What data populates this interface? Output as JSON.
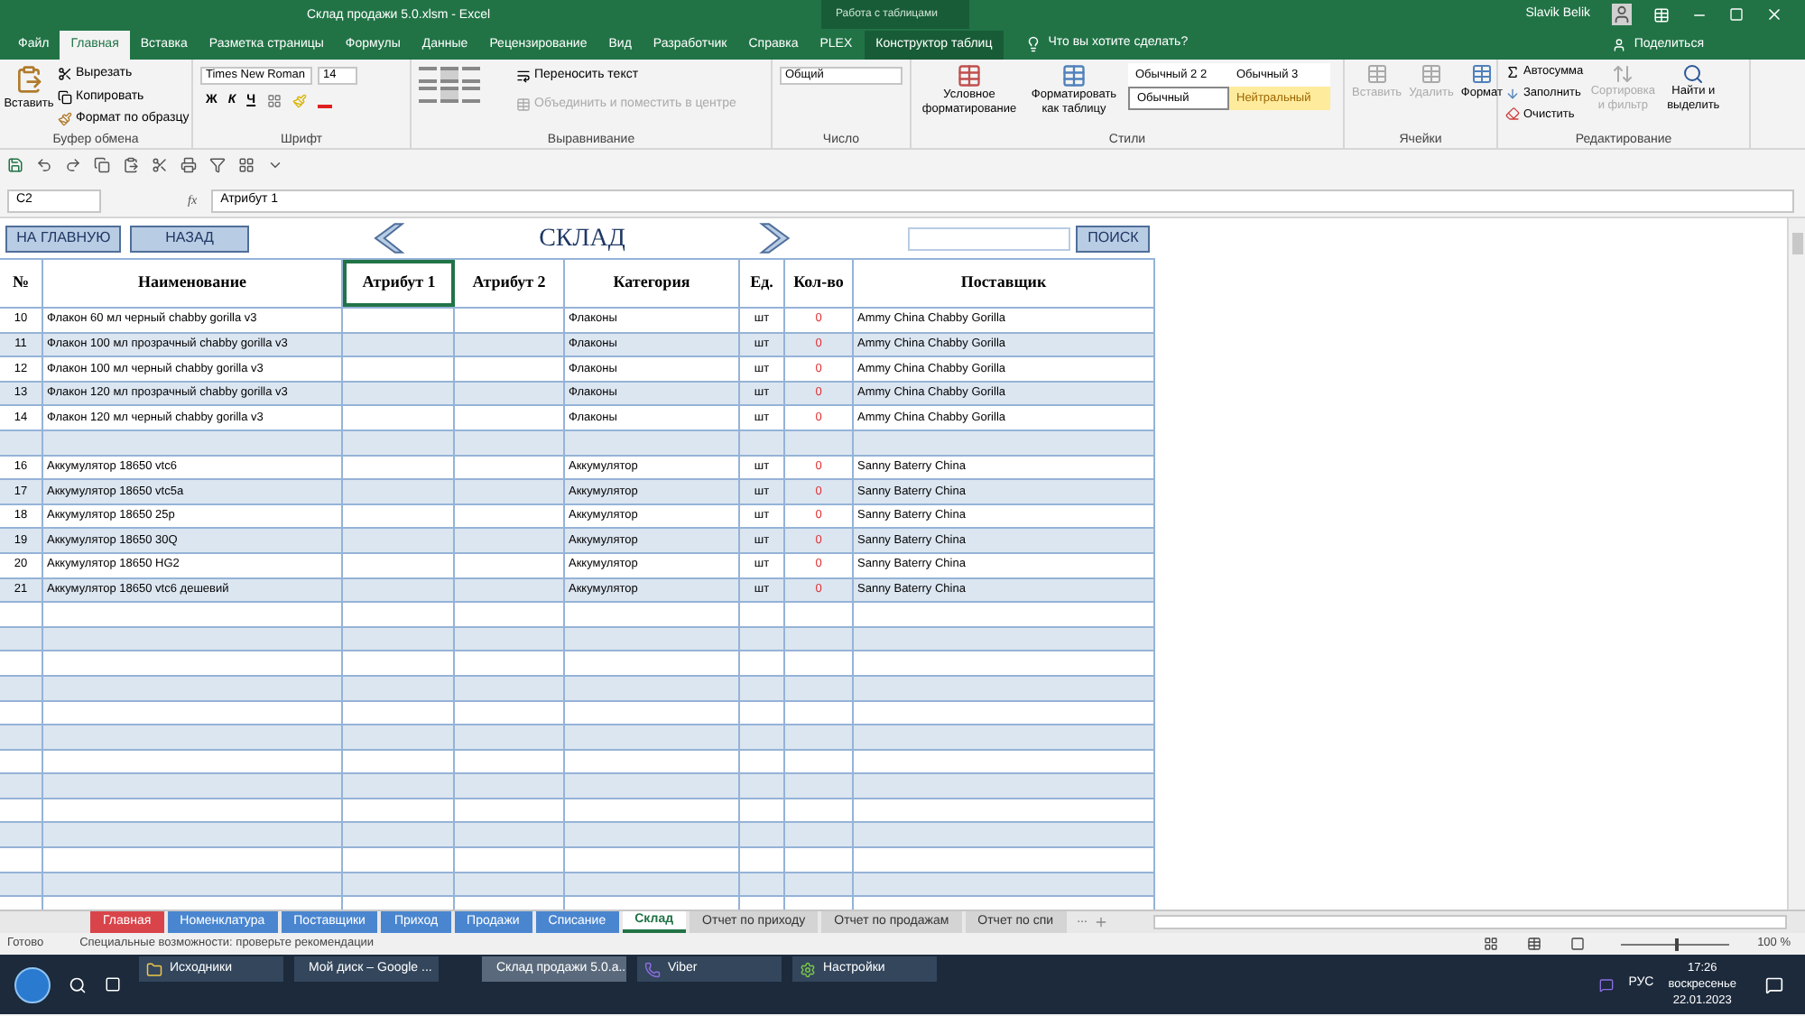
{
  "title_bar": {
    "title": "Склад продажи 5.0.xlsm  -  Excel",
    "context_label": "Работа с таблицами",
    "user_name": "Slavik Belik"
  },
  "menu_tabs": [
    {
      "label": "Файл",
      "selected": false
    },
    {
      "label": "Главная",
      "selected": true
    },
    {
      "label": "Вставка",
      "selected": false
    },
    {
      "label": "Разметка страницы",
      "selected": false
    },
    {
      "label": "Формулы",
      "selected": false
    },
    {
      "label": "Данные",
      "selected": false
    },
    {
      "label": "Рецензирование",
      "selected": false
    },
    {
      "label": "Вид",
      "selected": false
    },
    {
      "label": "Разработчик",
      "selected": false
    },
    {
      "label": "Справка",
      "selected": false
    },
    {
      "label": "PLEX",
      "selected": false
    },
    {
      "label": "Конструктор таблиц",
      "selected": false
    }
  ],
  "tell_me": "Что вы хотите сделать?",
  "share": "Поделиться",
  "ribbon": {
    "clipboard": {
      "paste": "Вставить",
      "cut": "Вырезать",
      "copy": "Копировать",
      "format_painter": "Формат по образцу",
      "label": "Буфер обмена"
    },
    "font": {
      "family": "Times New Roman",
      "size": "14",
      "format_buttons": [
        "Ж",
        "К",
        "Ч"
      ],
      "label": "Шрифт"
    },
    "alignment": {
      "wrap": "Переносить текст",
      "merge": "Объединить и поместить в центре",
      "label": "Выравнивание"
    },
    "number": {
      "format": "Общий",
      "label": "Число"
    },
    "styles": {
      "conditional": "Условное форматирование",
      "as_table": "Форматировать как таблицу",
      "cells": [
        {
          "label": "Обычный 2 2",
          "kind": "plain",
          "selected": false
        },
        {
          "label": "Обычный 3",
          "kind": "plain",
          "selected": false
        },
        {
          "label": "Обычный",
          "kind": "plain",
          "selected": true
        },
        {
          "label": "Нейтральный",
          "kind": "neutral",
          "selected": false
        }
      ],
      "label": "Стили"
    },
    "cells": {
      "insert": "Вставить",
      "delete": "Удалить",
      "format": "Формат",
      "label": "Ячейки"
    },
    "editing": {
      "autosum": "Автосумма",
      "fill": "Заполнить",
      "clear": "Очистить",
      "sort": "Сортировка и фильтр",
      "find": "Найти и выделить",
      "label": "Редактирование"
    }
  },
  "formula_bar": {
    "name_box": "C2",
    "fx": "fx",
    "formula": "Атрибут 1"
  },
  "sheet": {
    "home_button": "НА ГЛАВНУЮ",
    "back_button": "НАЗАД",
    "title": "СКЛАД",
    "search_button": "ПОИСК",
    "columns": [
      {
        "label": "№",
        "selected": false
      },
      {
        "label": "Наименование",
        "selected": false
      },
      {
        "label": "Атрибут 1",
        "selected": true
      },
      {
        "label": "Атрибут 2",
        "selected": false
      },
      {
        "label": "Категория",
        "selected": false
      },
      {
        "label": "Ед.",
        "selected": false
      },
      {
        "label": "Кол-во",
        "selected": false
      },
      {
        "label": "Поставщик",
        "selected": false
      }
    ],
    "rows": [
      {
        "kind": "item",
        "number": "10",
        "name": "Флакон 60 мл черный chabby gorilla v3",
        "category": "Флаконы",
        "unit": "шт",
        "qty": "0",
        "supplier": "Ammy China Chabby Gorilla"
      },
      {
        "kind": "item",
        "number": "11",
        "name": "Флакон 100 мл прозрачный chabby gorilla v3",
        "category": "Флаконы",
        "unit": "шт",
        "qty": "0",
        "supplier": "Ammy China Chabby Gorilla"
      },
      {
        "kind": "item",
        "number": "12",
        "name": "Флакон 100 мл черный chabby gorilla v3",
        "category": "Флаконы",
        "unit": "шт",
        "qty": "0",
        "supplier": "Ammy China Chabby Gorilla"
      },
      {
        "kind": "item",
        "number": "13",
        "name": "Флакон 120 мл прозрачный chabby gorilla v3",
        "category": "Флаконы",
        "unit": "шт",
        "qty": "0",
        "supplier": "Ammy China Chabby Gorilla"
      },
      {
        "kind": "item",
        "number": "14",
        "name": "Флакон 120 мл черный chabby gorilla v3",
        "category": "Флаконы",
        "unit": "шт",
        "qty": "0",
        "supplier": "Ammy China Chabby Gorilla"
      },
      {
        "kind": "blank"
      },
      {
        "kind": "item",
        "number": "16",
        "name": "Аккумулятор 18650 vtc6",
        "category": "Аккумулятор",
        "unit": "шт",
        "qty": "0",
        "supplier": "Sanny Baterry China"
      },
      {
        "kind": "item",
        "number": "17",
        "name": "Аккумулятор 18650 vtc5a",
        "category": "Аккумулятор",
        "unit": "шт",
        "qty": "0",
        "supplier": "Sanny Baterry China"
      },
      {
        "kind": "item",
        "number": "18",
        "name": "Аккумулятор 18650 25p",
        "category": "Аккумулятор",
        "unit": "шт",
        "qty": "0",
        "supplier": "Sanny Baterry China"
      },
      {
        "kind": "item",
        "number": "19",
        "name": "Аккумулятор 18650 30Q",
        "category": "Аккумулятор",
        "unit": "шт",
        "qty": "0",
        "supplier": "Sanny Baterry China"
      },
      {
        "kind": "item",
        "number": "20",
        "name": "Аккумулятор 18650 HG2",
        "category": "Аккумулятор",
        "unit": "шт",
        "qty": "0",
        "supplier": "Sanny Baterry China"
      },
      {
        "kind": "item",
        "number": "21",
        "name": "Аккумулятор 18650 vtc6 дешевий",
        "category": "Аккумулятор",
        "unit": "шт",
        "qty": "0",
        "supplier": "Sanny Baterry China"
      }
    ]
  },
  "sheet_tabs": [
    {
      "label": "Главная",
      "color": "#d9444a",
      "selected": false
    },
    {
      "label": "Номенклатура",
      "color": "#4a86d0",
      "selected": false
    },
    {
      "label": "Поставщики",
      "color": "#4a86d0",
      "selected": false
    },
    {
      "label": "Приход",
      "color": "#4a86d0",
      "selected": false
    },
    {
      "label": "Продажи",
      "color": "#4a86d0",
      "selected": false
    },
    {
      "label": "Списание",
      "color": "#4a86d0",
      "selected": false
    },
    {
      "label": "Склад",
      "color": "#ffffff",
      "selected": true
    },
    {
      "label": "Отчет по приходу",
      "color": "#d4d4d4",
      "selected": false
    },
    {
      "label": "Отчет по продажам",
      "color": "#d4d4d4",
      "selected": false
    },
    {
      "label": "Отчет по спи",
      "color": "#d4d4d4",
      "selected": false
    }
  ],
  "sheet_tabs_more": "...",
  "status_bar": {
    "ready": "Готово",
    "accessibility": "Специальные возможности: проверьте рекомендации",
    "zoom": "100 %",
    "zoom_slider": {
      "level": 0.5
    }
  },
  "taskbar": {
    "apps": [
      {
        "label": "Исходники",
        "kind": "folder",
        "selected": false
      },
      {
        "label": "Мой диск – Google ...",
        "kind": "browser",
        "selected": false
      },
      {
        "label": "Склад продажи 5.0.a...",
        "kind": "excel",
        "selected": true
      },
      {
        "label": "Viber",
        "kind": "viber",
        "selected": false
      },
      {
        "label": "Настройки",
        "kind": "settings",
        "selected": false
      }
    ],
    "language": "РУС",
    "time": "17:26",
    "weekday": "воскресенье",
    "date": "22.01.2023"
  }
}
